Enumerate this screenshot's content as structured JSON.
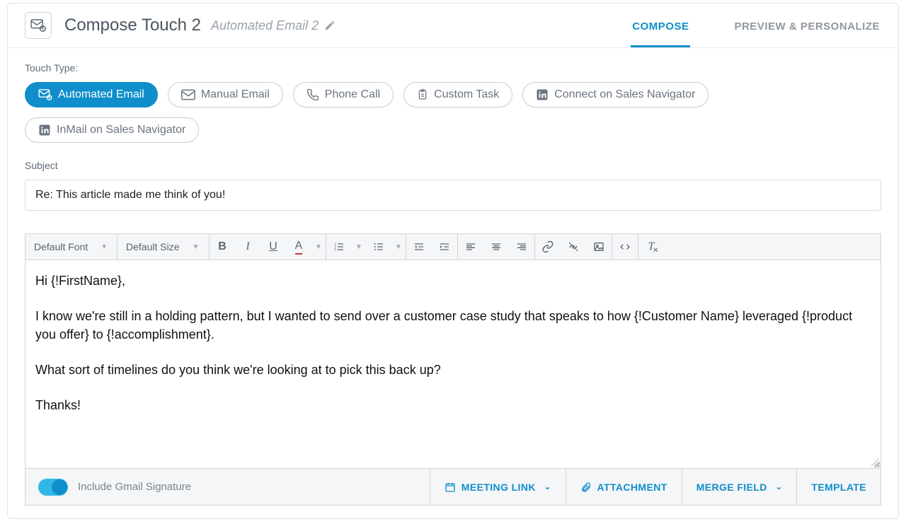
{
  "header": {
    "title": "Compose Touch 2",
    "subtitle": "Automated Email 2"
  },
  "tabs": {
    "compose": "COMPOSE",
    "preview": "PREVIEW & PERSONALIZE"
  },
  "touch_type": {
    "label": "Touch Type:",
    "options": [
      {
        "key": "automated_email",
        "label": "Automated Email",
        "icon": "mail-auto",
        "active": true
      },
      {
        "key": "manual_email",
        "label": "Manual Email",
        "icon": "mail",
        "active": false
      },
      {
        "key": "phone_call",
        "label": "Phone Call",
        "icon": "phone",
        "active": false
      },
      {
        "key": "custom_task",
        "label": "Custom Task",
        "icon": "clipboard",
        "active": false
      },
      {
        "key": "connect_sn",
        "label": "Connect on Sales Navigator",
        "icon": "linkedin",
        "active": false
      },
      {
        "key": "inmail_sn",
        "label": "InMail on Sales Navigator",
        "icon": "linkedin",
        "active": false
      }
    ]
  },
  "subject": {
    "label": "Subject",
    "value": "Re: This article made me think of you!"
  },
  "toolbar": {
    "font_select": "Default Font",
    "size_select": "Default Size"
  },
  "email_body": {
    "line1": "Hi {!FirstName},",
    "line2": "I know we're still in a holding pattern, but I wanted to send over a customer case study that speaks to how {!Customer Name} leveraged {!product you offer} to {!accomplishment}.",
    "line3": "What sort of timelines do you think we're looking at to pick this back up?",
    "line4": "Thanks!"
  },
  "footer": {
    "signature_toggle_label": "Include Gmail Signature",
    "meeting_link": "MEETING LINK",
    "attachment": "ATTACHMENT",
    "merge_field": "MERGE FIELD",
    "template": "TEMPLATE"
  }
}
